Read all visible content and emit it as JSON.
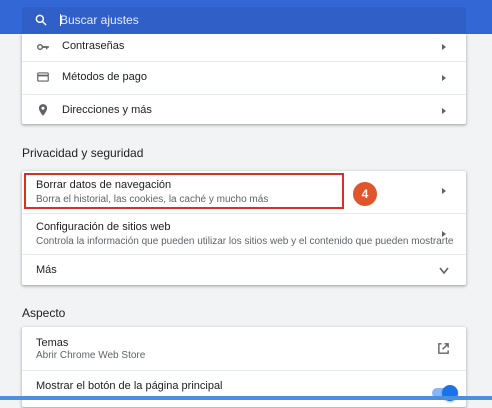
{
  "search": {
    "placeholder": "Buscar ajustes",
    "icon": "search-icon"
  },
  "autofill": {
    "items": [
      {
        "label": "Contraseñas",
        "icon": "key-icon"
      },
      {
        "label": "Métodos de pago",
        "icon": "credit-card-icon"
      },
      {
        "label": "Direcciones y más",
        "icon": "location-pin-icon"
      }
    ]
  },
  "privacy": {
    "title": "Privacidad y seguridad",
    "items": [
      {
        "label": "Borrar datos de navegación",
        "sublabel": "Borra el historial, las cookies, la caché y mucho más",
        "step": "4"
      },
      {
        "label": "Configuración de sitios web",
        "sublabel": "Controla la información que pueden utilizar los sitios web y el contenido que pueden mostrarte"
      },
      {
        "label": "Más"
      }
    ]
  },
  "appearance": {
    "title": "Aspecto",
    "items": [
      {
        "label": "Temas",
        "sublabel": "Abrir Chrome Web Store",
        "icon": "external-link-icon"
      },
      {
        "label": "Mostrar el botón de la página principal",
        "toggle": true
      }
    ]
  },
  "colors": {
    "header": "#3367d6",
    "accent": "#1a73e8",
    "highlight": "#d93025",
    "badge": "#e0552b"
  }
}
